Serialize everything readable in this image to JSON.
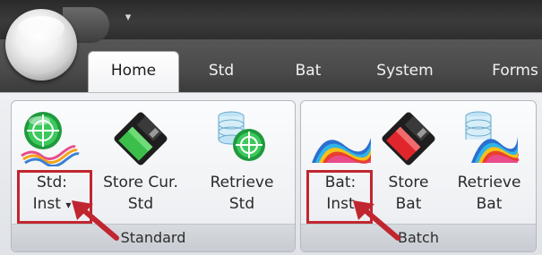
{
  "tabs": [
    "Home",
    "Std",
    "Bat",
    "System",
    "Forms"
  ],
  "standard_group": {
    "title": "Standard",
    "std_inst": {
      "line1": "Std:",
      "line2": "Inst",
      "dropdown": "▾"
    },
    "store_std": {
      "line1": "Store Cur.",
      "line2": "Std"
    },
    "retrieve_std": {
      "line1": "Retrieve",
      "line2": "Std"
    }
  },
  "batch_group": {
    "title": "Batch",
    "bat_inst": {
      "line1": "Bat:",
      "line2": "Inst"
    },
    "store_bat": {
      "line1": "Store",
      "line2": "Bat"
    },
    "retrieve_bat": {
      "line1": "Retrieve",
      "line2": "Bat"
    }
  },
  "icons": {
    "orb": "application-orb",
    "qat": "quick-access-dropdown-icon",
    "std_inst": "target-crosshair-icon",
    "store_std": "floppy-disk-green-icon",
    "retrieve_std": "database-target-icon",
    "bat_inst": "spectrum-layers-icon",
    "store_bat": "floppy-disk-red-icon",
    "retrieve_bat": "database-spectrum-icon",
    "callout": "red-arrow-icon"
  },
  "colors": {
    "highlight": "#c0262f",
    "std_disk": "#3bbf4a",
    "bat_disk": "#e0262c",
    "target_green": "#28b34a"
  }
}
